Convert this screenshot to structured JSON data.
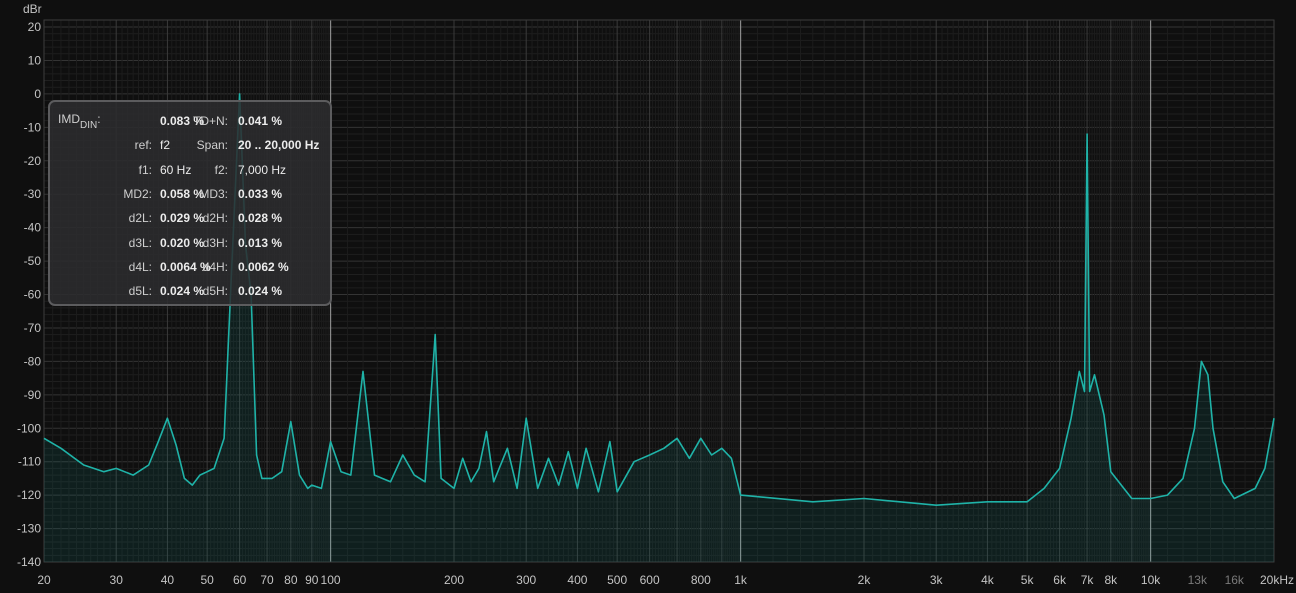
{
  "chart_data": {
    "type": "line",
    "title": "",
    "ylabel": "dBr",
    "xlabel": "",
    "x_scale": "log",
    "xlim": [
      20,
      20000
    ],
    "ylim": [
      -140,
      20
    ],
    "grid": true,
    "y_ticks": [
      "20",
      "10",
      "0",
      "-10",
      "-20",
      "-30",
      "-40",
      "-50",
      "-60",
      "-70",
      "-80",
      "-90",
      "-100",
      "-110",
      "-120",
      "-130",
      "-140"
    ],
    "x_ticks": [
      {
        "v": 20,
        "label": "20",
        "dim": false
      },
      {
        "v": 30,
        "label": "30",
        "dim": false
      },
      {
        "v": 40,
        "label": "40",
        "dim": false
      },
      {
        "v": 50,
        "label": "50",
        "dim": false
      },
      {
        "v": 60,
        "label": "60",
        "dim": false
      },
      {
        "v": 70,
        "label": "70",
        "dim": false
      },
      {
        "v": 80,
        "label": "80",
        "dim": false
      },
      {
        "v": 90,
        "label": "90",
        "dim": false
      },
      {
        "v": 100,
        "label": "100",
        "dim": false
      },
      {
        "v": 200,
        "label": "200",
        "dim": false
      },
      {
        "v": 300,
        "label": "300",
        "dim": false
      },
      {
        "v": 400,
        "label": "400",
        "dim": false
      },
      {
        "v": 500,
        "label": "500",
        "dim": false
      },
      {
        "v": 600,
        "label": "600",
        "dim": false
      },
      {
        "v": 800,
        "label": "800",
        "dim": false
      },
      {
        "v": 1000,
        "label": "1k",
        "dim": false
      },
      {
        "v": 2000,
        "label": "2k",
        "dim": false
      },
      {
        "v": 3000,
        "label": "3k",
        "dim": false
      },
      {
        "v": 4000,
        "label": "4k",
        "dim": false
      },
      {
        "v": 5000,
        "label": "5k",
        "dim": false
      },
      {
        "v": 6000,
        "label": "6k",
        "dim": false
      },
      {
        "v": 7000,
        "label": "7k",
        "dim": false
      },
      {
        "v": 8000,
        "label": "8k",
        "dim": false
      },
      {
        "v": 10000,
        "label": "10k",
        "dim": false
      },
      {
        "v": 13000,
        "label": "13k",
        "dim": true
      },
      {
        "v": 16000,
        "label": "16k",
        "dim": true
      },
      {
        "v": 20000,
        "label": "20kHz",
        "dim": false
      }
    ],
    "colors": {
      "trace": "#1fb3a8",
      "fill": "#14908a",
      "background": "#0f0f0f",
      "grid": "#2a2a2a",
      "grid_major": "#8a8a8a"
    },
    "series": [
      {
        "name": "",
        "points": [
          [
            20,
            -103
          ],
          [
            22,
            -106
          ],
          [
            25,
            -111
          ],
          [
            28,
            -113
          ],
          [
            30,
            -112
          ],
          [
            33,
            -114
          ],
          [
            36,
            -111
          ],
          [
            38,
            -104
          ],
          [
            40,
            -97
          ],
          [
            42,
            -105
          ],
          [
            44,
            -115
          ],
          [
            46,
            -117
          ],
          [
            48,
            -114
          ],
          [
            50,
            -113
          ],
          [
            52,
            -112
          ],
          [
            55,
            -103
          ],
          [
            57,
            -60
          ],
          [
            60,
            0
          ],
          [
            62,
            -45
          ],
          [
            64,
            -60
          ],
          [
            66,
            -108
          ],
          [
            68,
            -115
          ],
          [
            72,
            -115
          ],
          [
            76,
            -113
          ],
          [
            80,
            -98
          ],
          [
            84,
            -114
          ],
          [
            88,
            -118
          ],
          [
            90,
            -117
          ],
          [
            95,
            -118
          ],
          [
            100,
            -104
          ],
          [
            106,
            -113
          ],
          [
            112,
            -114
          ],
          [
            120,
            -83
          ],
          [
            128,
            -114
          ],
          [
            140,
            -116
          ],
          [
            150,
            -108
          ],
          [
            160,
            -114
          ],
          [
            170,
            -116
          ],
          [
            180,
            -72
          ],
          [
            186,
            -115
          ],
          [
            200,
            -118
          ],
          [
            210,
            -109
          ],
          [
            220,
            -116
          ],
          [
            230,
            -112
          ],
          [
            240,
            -101
          ],
          [
            250,
            -116
          ],
          [
            270,
            -106
          ],
          [
            285,
            -118
          ],
          [
            300,
            -97
          ],
          [
            320,
            -118
          ],
          [
            340,
            -109
          ],
          [
            360,
            -117
          ],
          [
            380,
            -107
          ],
          [
            400,
            -118
          ],
          [
            420,
            -106
          ],
          [
            450,
            -119
          ],
          [
            480,
            -104
          ],
          [
            500,
            -119
          ],
          [
            550,
            -110
          ],
          [
            600,
            -108
          ],
          [
            650,
            -106
          ],
          [
            700,
            -103
          ],
          [
            750,
            -109
          ],
          [
            800,
            -103
          ],
          [
            850,
            -108
          ],
          [
            900,
            -106
          ],
          [
            950,
            -109
          ],
          [
            1000,
            -120
          ],
          [
            1500,
            -122
          ],
          [
            2000,
            -121
          ],
          [
            3000,
            -123
          ],
          [
            4000,
            -122
          ],
          [
            5000,
            -122
          ],
          [
            5500,
            -118
          ],
          [
            6000,
            -112
          ],
          [
            6400,
            -97
          ],
          [
            6700,
            -83
          ],
          [
            6900,
            -89
          ],
          [
            7000,
            -12
          ],
          [
            7100,
            -89
          ],
          [
            7300,
            -84
          ],
          [
            7700,
            -96
          ],
          [
            8000,
            -113
          ],
          [
            9000,
            -121
          ],
          [
            10000,
            -121
          ],
          [
            11000,
            -120
          ],
          [
            12000,
            -115
          ],
          [
            12800,
            -100
          ],
          [
            13300,
            -80
          ],
          [
            13800,
            -84
          ],
          [
            14200,
            -100
          ],
          [
            15000,
            -116
          ],
          [
            16000,
            -121
          ],
          [
            18000,
            -118
          ],
          [
            19000,
            -112
          ],
          [
            20000,
            -97
          ]
        ]
      }
    ]
  },
  "readout": {
    "imd_main": "IMD",
    "imd_sub": "DIN",
    "imd_sep": ":",
    "rows": [
      {
        "l1": "",
        "v1": "0.083 %",
        "l2": "TD+N:",
        "v2": "0.041 %",
        "b1": true,
        "b2": true
      },
      {
        "l1": "ref:",
        "v1": "f2",
        "l2": "Span:",
        "v2": "20 .. 20,000 Hz",
        "b1": false,
        "b2": true
      },
      {
        "l1": "f1:",
        "v1": "60 Hz",
        "l2": "f2:",
        "v2": "7,000 Hz",
        "b1": false,
        "b2": false
      },
      {
        "l1": "MD2:",
        "v1": "0.058 %",
        "l2": "MD3:",
        "v2": "0.033 %",
        "b1": true,
        "b2": true
      },
      {
        "l1": "d2L:",
        "v1": "0.029 %",
        "l2": "d2H:",
        "v2": "0.028 %",
        "b1": true,
        "b2": true
      },
      {
        "l1": "d3L:",
        "v1": "0.020 %",
        "l2": "d3H:",
        "v2": "0.013 %",
        "b1": true,
        "b2": true
      },
      {
        "l1": "d4L:",
        "v1": "0.0064 %",
        "l2": "d4H:",
        "v2": "0.0062 %",
        "b1": true,
        "b2": true
      },
      {
        "l1": "d5L:",
        "v1": "0.024 %",
        "l2": "d5H:",
        "v2": "0.024 %",
        "b1": true,
        "b2": true
      }
    ]
  }
}
